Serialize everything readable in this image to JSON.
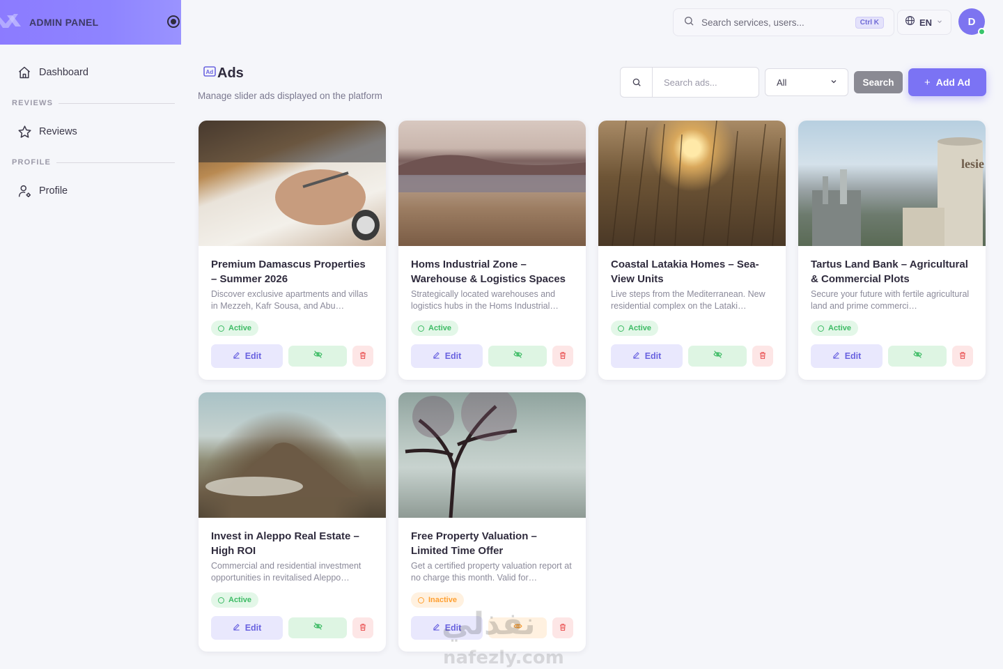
{
  "brand": {
    "title": "ADMIN PANEL"
  },
  "sidebar": {
    "items": [
      {
        "type": "item",
        "label": "Dashboard",
        "icon": "home-icon"
      },
      {
        "type": "section",
        "label": "REVIEWS"
      },
      {
        "type": "item",
        "label": "Reviews",
        "icon": "star-icon"
      },
      {
        "type": "section",
        "label": "PROFILE"
      },
      {
        "type": "item",
        "label": "Profile",
        "icon": "user-settings-icon"
      }
    ]
  },
  "topbar": {
    "search_placeholder": "Search services, users...",
    "shortcut": "Ctrl K",
    "language": "EN",
    "avatar_initial": "D"
  },
  "page": {
    "title": "Ads",
    "subtitle": "Manage slider ads displayed on the platform",
    "search_placeholder": "Search ads...",
    "status_filter": "All",
    "search_button": "Search",
    "add_button": "Add Ad"
  },
  "ads": [
    {
      "title": "Premium Damascus Properties – Summer 2026",
      "description": "Discover exclusive apartments and villas in Mezzeh, Kafr Sousa, and Abu…",
      "status": "Active",
      "image": "hand-writing-notebook-photo"
    },
    {
      "title": "Homs Industrial Zone – Warehouse & Logistics Spaces",
      "description": "Strategically located warehouses and logistics hubs in the Homs Industrial…",
      "status": "Active",
      "image": "lake-dry-grass-photo"
    },
    {
      "title": "Coastal Latakia Homes – Sea-View Units",
      "description": "Live steps from the Mediterranean. New residential complex on the Lataki…",
      "status": "Active",
      "image": "sunset-reeds-photo"
    },
    {
      "title": "Tartus Land Bank – Agricultural & Commercial Plots",
      "description": "Secure your future with fertile agricultural land and prime commerci…",
      "status": "Active",
      "image": "industrial-tanks-photo"
    },
    {
      "title": "Invest in Aleppo Real Estate – High ROI",
      "description": "Commercial and residential investment opportunities in revitalised Aleppo…",
      "status": "Active",
      "image": "volcano-landscape-photo"
    },
    {
      "title": "Free Property Valuation – Limited Time Offer",
      "description": "Get a certified property valuation report at no charge this month. Valid for…",
      "status": "Inactive",
      "image": "misty-tree-photo"
    }
  ],
  "card_actions": {
    "edit": "Edit"
  },
  "watermark": {
    "text_ar": "نفذلي",
    "text_en": "nafezly.com"
  },
  "colors": {
    "primary": "#7b73f4",
    "active": "#3cbb64",
    "inactive": "#ff9f30",
    "danger": "#ea5455"
  }
}
